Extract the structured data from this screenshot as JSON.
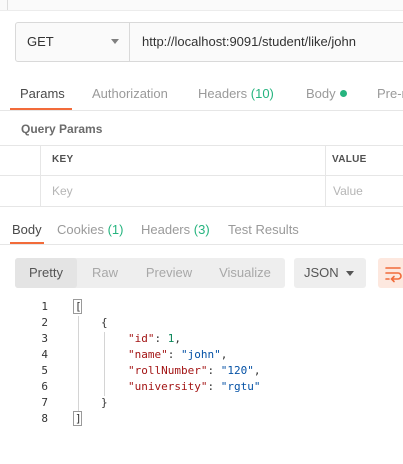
{
  "request": {
    "method": "GET",
    "url": "http://localhost:9091/student/like/john"
  },
  "request_tabs": {
    "params": "Params",
    "authorization": "Authorization",
    "headers_label": "Headers",
    "headers_count": "(10)",
    "body": "Body",
    "pre_request": "Pre-r"
  },
  "query_params": {
    "title": "Query Params",
    "key_header": "KEY",
    "value_header": "VALUE",
    "key_placeholder": "Key",
    "value_placeholder": "Value"
  },
  "response_tabs": {
    "body": "Body",
    "cookies_label": "Cookies",
    "cookies_count": "(1)",
    "headers_label": "Headers",
    "headers_count": "(3)",
    "test_results": "Test Results"
  },
  "view_options": [
    "Pretty",
    "Raw",
    "Preview",
    "Visualize"
  ],
  "format": "JSON",
  "response_body": {
    "line_numbers": [
      "1",
      "2",
      "3",
      "4",
      "5",
      "6",
      "7",
      "8"
    ],
    "open_bracket": "[",
    "open_brace": "{",
    "fields": [
      {
        "key": "\"id\"",
        "value": "1",
        "trail": ","
      },
      {
        "key": "\"name\"",
        "value": "\"john\"",
        "trail": ","
      },
      {
        "key": "\"rollNumber\"",
        "value": "\"120\"",
        "trail": ","
      },
      {
        "key": "\"university\"",
        "value": "\"rgtu\"",
        "trail": ""
      }
    ],
    "close_brace": "}",
    "close_bracket": "]"
  },
  "colors": {
    "accent": "#f26b3a",
    "green": "#26b47f",
    "json_key": "#a31515",
    "json_string": "#0451a5",
    "json_number": "#098658"
  }
}
